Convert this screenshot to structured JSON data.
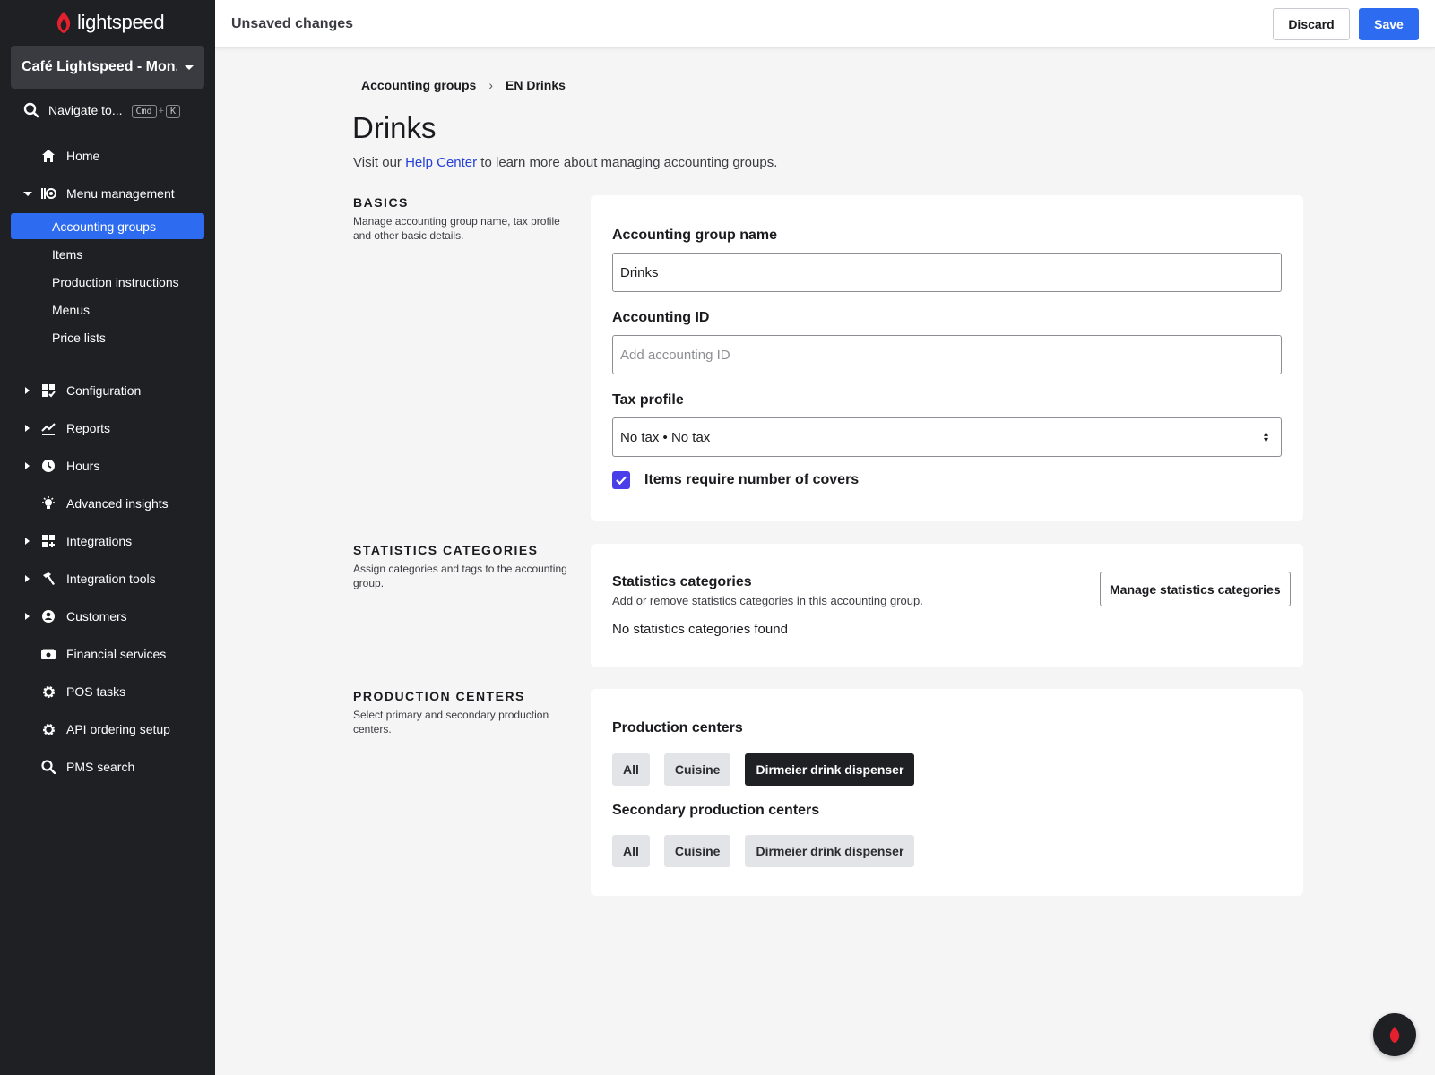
{
  "brand": {
    "name": "lightspeed",
    "accent": "#e4202e"
  },
  "venue": {
    "name": "Café Lightspeed - Mon..."
  },
  "navigate": {
    "label": "Navigate to...",
    "key1": "Cmd",
    "plus": "+",
    "key2": "K"
  },
  "sidebar": {
    "items": [
      {
        "label": "Home",
        "icon": "home-icon"
      },
      {
        "label": "Menu management",
        "icon": "menu-management-icon",
        "expanded": true
      },
      {
        "label": "Configuration",
        "icon": "configuration-icon"
      },
      {
        "label": "Reports",
        "icon": "reports-icon"
      },
      {
        "label": "Hours",
        "icon": "clock-icon"
      },
      {
        "label": "Advanced insights",
        "icon": "lightbulb-icon"
      },
      {
        "label": "Integrations",
        "icon": "integrations-icon"
      },
      {
        "label": "Integration tools",
        "icon": "hammer-icon"
      },
      {
        "label": "Customers",
        "icon": "customer-icon"
      },
      {
        "label": "Financial services",
        "icon": "financial-icon"
      },
      {
        "label": "POS tasks",
        "icon": "gear-icon"
      },
      {
        "label": "API ordering setup",
        "icon": "gear-icon"
      },
      {
        "label": "PMS search",
        "icon": "search-icon"
      }
    ],
    "sub_items": [
      "Accounting groups",
      "Items",
      "Production instructions",
      "Menus",
      "Price lists"
    ],
    "active_sub": "Accounting groups"
  },
  "topbar": {
    "title": "Unsaved changes",
    "discard_label": "Discard",
    "save_label": "Save"
  },
  "breadcrumb": {
    "parent": "Accounting groups",
    "current": "EN Drinks"
  },
  "page": {
    "title": "Drinks",
    "intro_before": "Visit our ",
    "intro_link": "Help Center",
    "intro_after": " to learn more about managing accounting groups."
  },
  "basics": {
    "heading": "BASICS",
    "description": "Manage accounting group name, tax profile and other basic details.",
    "name_label": "Accounting group name",
    "name_value": "Drinks",
    "id_label": "Accounting ID",
    "id_placeholder": "Add accounting ID",
    "tax_label": "Tax profile",
    "tax_value": "No tax • No tax",
    "covers_label": "Items require number of covers",
    "covers_checked": true
  },
  "statistics": {
    "heading": "STATISTICS CATEGORIES",
    "description": "Assign categories and tags to the accounting group.",
    "title": "Statistics categories",
    "subtitle": "Add or remove statistics categories in this accounting group.",
    "empty_text": "No statistics categories found",
    "manage_label": "Manage statistics categories"
  },
  "production": {
    "heading": "PRODUCTION CENTERS",
    "description": "Select primary and secondary production centers.",
    "primary_label": "Production centers",
    "primary_options": [
      "All",
      "Cuisine",
      "Dirmeier drink dispenser"
    ],
    "primary_selected": "Dirmeier drink dispenser",
    "secondary_label": "Secondary production centers",
    "secondary_options": [
      "All",
      "Cuisine",
      "Dirmeier drink dispenser"
    ]
  }
}
